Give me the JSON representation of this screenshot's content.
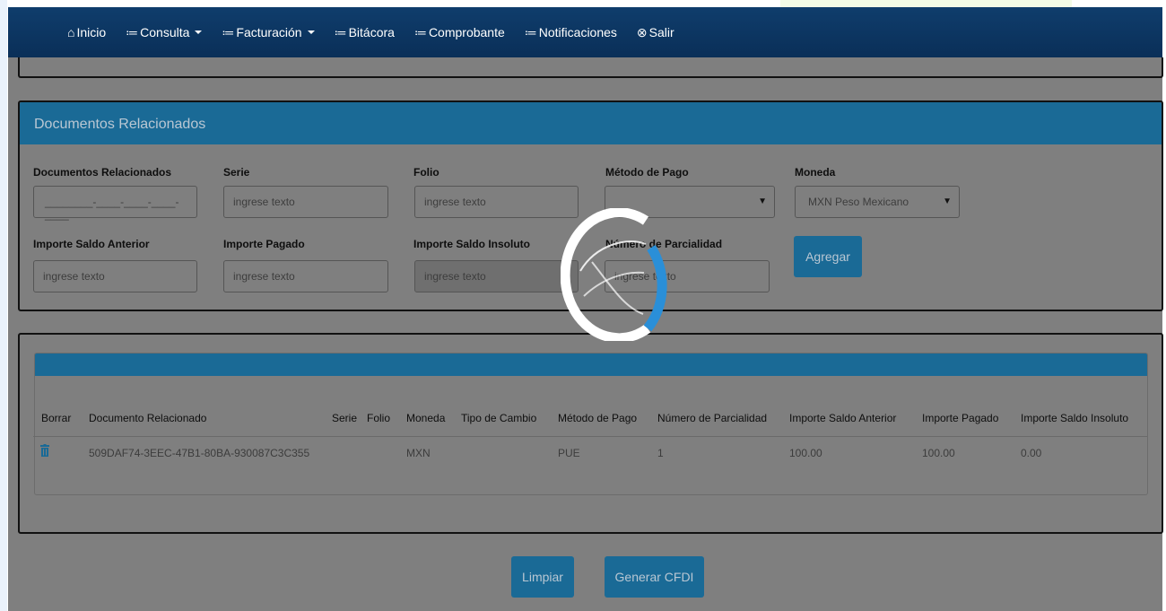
{
  "nav": {
    "items": [
      {
        "icon": "home-icon",
        "glyph": "⌂",
        "label": "Inicio",
        "caret": false
      },
      {
        "icon": "list-icon",
        "glyph": "≔",
        "label": "Consulta",
        "caret": true
      },
      {
        "icon": "list-icon",
        "glyph": "≔",
        "label": "Facturación",
        "caret": true
      },
      {
        "icon": "list-icon",
        "glyph": "≔",
        "label": "Bitácora",
        "caret": false
      },
      {
        "icon": "list-icon",
        "glyph": "≔",
        "label": "Comprobante",
        "caret": false
      },
      {
        "icon": "list-icon",
        "glyph": "≔",
        "label": "Notificaciones",
        "caret": false
      },
      {
        "icon": "close-circle-icon",
        "glyph": "⊗",
        "label": "Salir",
        "caret": false
      }
    ]
  },
  "docs_panel": {
    "title": "Documentos Relacionados",
    "fields": {
      "documentos_relacionados": {
        "label": "Documentos Relacionados",
        "value": "________-____-____-____-____"
      },
      "serie": {
        "label": "Serie",
        "placeholder": "ingrese texto"
      },
      "folio": {
        "label": "Folio",
        "placeholder": "ingrese texto"
      },
      "metodo_pago": {
        "label": "Método de Pago",
        "value": ""
      },
      "moneda": {
        "label": "Moneda",
        "value": "MXN Peso Mexicano"
      },
      "importe_saldo_anterior": {
        "label": "Importe Saldo Anterior",
        "placeholder": "ingrese texto"
      },
      "importe_pagado": {
        "label": "Importe Pagado",
        "placeholder": "ingrese texto"
      },
      "importe_saldo_insoluto": {
        "label": "Importe Saldo Insoluto",
        "placeholder": "ingrese texto"
      },
      "numero_parcialidad": {
        "label": "Número de Parcialidad",
        "placeholder": "ingrese texto"
      }
    },
    "add_button": "Agregar"
  },
  "table": {
    "headers": [
      "Borrar",
      "Documento Relacionado",
      "Serie",
      "Folio",
      "Moneda",
      "Tipo de Cambio",
      "Método de Pago",
      "Número de Parcialidad",
      "Importe Saldo Anterior",
      "Importe Pagado",
      "Importe Saldo Insoluto"
    ],
    "rows": [
      {
        "documento": "509DAF74-3EEC-47B1-80BA-930087C3C355",
        "serie": "",
        "folio": "",
        "moneda": "MXN",
        "tipo_cambio": "",
        "metodo": "PUE",
        "parcialidad": "1",
        "saldo_anterior": "100.00",
        "pagado": "100.00",
        "saldo_insoluto": "0.00"
      }
    ]
  },
  "actions": {
    "clear": "Limpiar",
    "generate": "Generar CFDI"
  },
  "colors": {
    "navbar": "#0f3d6c",
    "accent": "#1a6a96",
    "spinner_arc": "#2a8fd8"
  }
}
